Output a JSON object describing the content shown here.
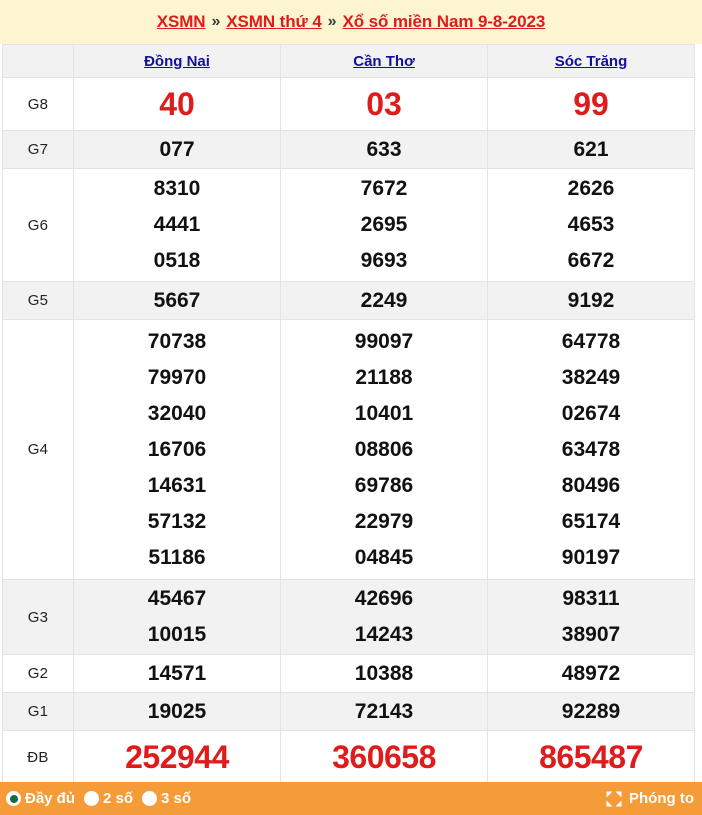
{
  "breadcrumb": {
    "items": [
      {
        "label": "XSMN",
        "type": "link"
      },
      {
        "label": "»",
        "type": "separator"
      },
      {
        "label": "XSMN thứ 4",
        "type": "link"
      },
      {
        "label": "»",
        "type": "separator"
      },
      {
        "label": "Xổ số miền Nam 9-8-2023",
        "type": "link"
      }
    ],
    "background_color": "#fdf5d0",
    "link_color": "#e01b1b"
  },
  "table": {
    "corner_label": "",
    "provinces": [
      "Đồng Nai",
      "Cần Thơ",
      "Sóc Trăng"
    ],
    "province_link_color": "#10109b",
    "rows": [
      {
        "prize": "G8",
        "style": "highlight-red",
        "values": [
          [
            "40"
          ],
          [
            "03"
          ],
          [
            "99"
          ]
        ]
      },
      {
        "prize": "G7",
        "style": "normal",
        "values": [
          [
            "077"
          ],
          [
            "633"
          ],
          [
            "621"
          ]
        ]
      },
      {
        "prize": "G6",
        "style": "normal",
        "values": [
          [
            "8310",
            "4441",
            "0518"
          ],
          [
            "7672",
            "2695",
            "9693"
          ],
          [
            "2626",
            "4653",
            "6672"
          ]
        ]
      },
      {
        "prize": "G5",
        "style": "normal",
        "values": [
          [
            "5667"
          ],
          [
            "2249"
          ],
          [
            "9192"
          ]
        ]
      },
      {
        "prize": "G4",
        "style": "normal",
        "values": [
          [
            "70738",
            "79970",
            "32040",
            "16706",
            "14631",
            "57132",
            "51186"
          ],
          [
            "99097",
            "21188",
            "10401",
            "08806",
            "69786",
            "22979",
            "04845"
          ],
          [
            "64778",
            "38249",
            "02674",
            "63478",
            "80496",
            "65174",
            "90197"
          ]
        ]
      },
      {
        "prize": "G3",
        "style": "normal",
        "values": [
          [
            "45467",
            "10015"
          ],
          [
            "42696",
            "14243"
          ],
          [
            "98311",
            "38907"
          ]
        ]
      },
      {
        "prize": "G2",
        "style": "normal",
        "values": [
          [
            "14571"
          ],
          [
            "10388"
          ],
          [
            "48972"
          ]
        ]
      },
      {
        "prize": "G1",
        "style": "normal",
        "values": [
          [
            "19025"
          ],
          [
            "72143"
          ],
          [
            "92289"
          ]
        ]
      },
      {
        "prize": "ĐB",
        "style": "highlight-red",
        "values": [
          [
            "252944"
          ],
          [
            "360658"
          ],
          [
            "865487"
          ]
        ]
      }
    ]
  },
  "toolbar": {
    "background_color": "#f59b38",
    "options": [
      {
        "label": "Đầy đủ",
        "selected": true
      },
      {
        "label": "2 số",
        "selected": false
      },
      {
        "label": "3 số",
        "selected": false
      }
    ],
    "selected_dot_color": "#1d6b3a",
    "zoom_button": {
      "label": "Phóng to",
      "icon": "expand-icon"
    }
  }
}
